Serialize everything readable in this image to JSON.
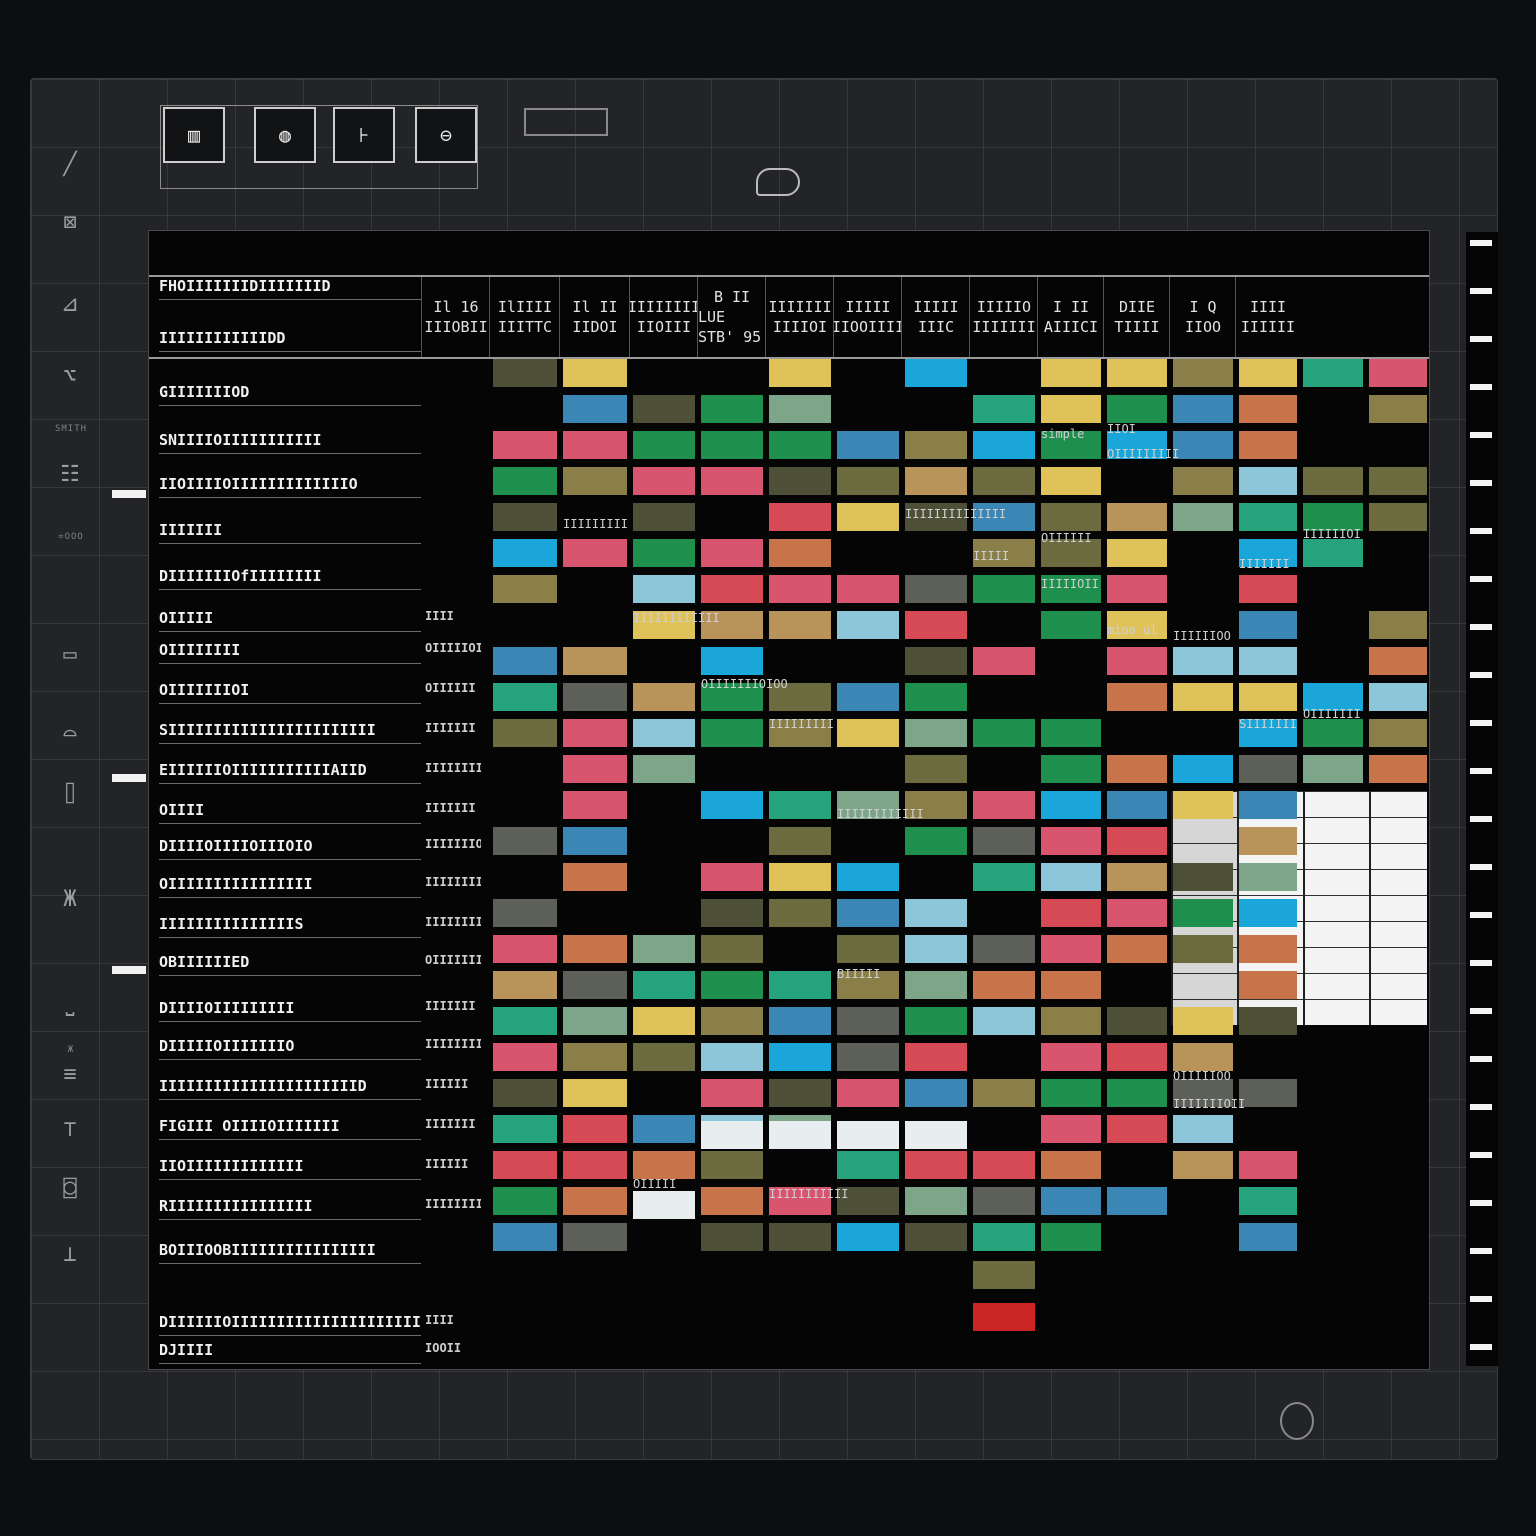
{
  "toolbar": {
    "buttons": [
      {
        "name": "grid-view-button",
        "glyph": "▥"
      },
      {
        "name": "globe-button",
        "glyph": "◍"
      },
      {
        "name": "split-button",
        "glyph": "⊦"
      },
      {
        "name": "lock-button",
        "glyph": "⊖"
      }
    ]
  },
  "left_rail": {
    "icons": [
      "╱",
      "⊠",
      "⊿",
      "⌥",
      "☷",
      "▭",
      "⌓",
      "⌷",
      "Ж",
      "⎵",
      "≡",
      "⊤",
      "⌼",
      "⊥"
    ],
    "labels": [
      "SMITH",
      "=OOO",
      "Ж"
    ]
  },
  "grid": {
    "column_headers": [
      [
        "Il 16",
        "IIIOBII"
      ],
      [
        "IlIIII",
        "IIITTC"
      ],
      [
        "Il II",
        "IIDOI"
      ],
      [
        "IIIIIIII",
        "IIOIII"
      ],
      [
        "B II",
        "LUE STB' 95"
      ],
      [
        "IIIIIII",
        "IIIIOI"
      ],
      [
        "IIIII",
        "IIOOIIII"
      ],
      [
        "IIIII",
        "IIIC"
      ],
      [
        "IIIIIO",
        "IIIIIII"
      ],
      [
        "I II",
        "AIIICI"
      ],
      [
        "DIIE",
        "TIIII"
      ],
      [
        "I Q",
        "IIOO"
      ],
      [
        "IIII",
        "IIIIII"
      ]
    ],
    "row_labels": [
      "FHOIIIIIIIDIIIIIIID",
      "IIIIIIIIIIIIDD",
      "GIIIIIIIOD",
      "SNIIIIOIIIIIIIIIII",
      "IIOIIIIOIIIIIIIIIIIIIO",
      "IIIIIII",
      "DIIIIIIIOfIIIIIIII",
      "OIIIII",
      "OIIIIIIII",
      "OIIIIIIIOI",
      "SIIIIIIIIIIIIIIIIIIIIIII",
      "EIIIIIIOIIIIIIIIIIIAIID",
      "OIIII",
      "DIIIIOIIIIOIIIOIO",
      "OIIIIIIIIIIIIIIII",
      "IIIIIIIIIIIIIIIS",
      "OBIIIIIIED",
      "DIIIIOIIIIIIIII",
      "DIIIIIOIIIIIIIO",
      "IIIIIIIIIIIIIIIIIIIIIID",
      "FIGIII OIIIIOIIIIIII",
      "IIOIIIIIIIIIIIII",
      "RIIIIIIIIIIIIIIII",
      "BOIIIOOBIIIIIIIIIIIIIIII",
      "DIIIIIIOIIIIIIIIIIIIIIIIIIIIIIIIOIIIIII",
      "DJIIII"
    ],
    "row_subs": [
      "",
      "",
      "",
      "",
      "",
      "",
      "",
      "IIII",
      "OIIIIIOI",
      "OIIIIII",
      "IIIIIII",
      "IIIIIIIIO",
      "IIIIIII",
      "IIIIIIIO",
      "IIIIIIII",
      "IIIIIIIIIIII",
      "OIIIIIII",
      "IIIIIII",
      "IIIIIIII",
      "IIIIII",
      "IIIIIII",
      "IIIIII",
      "IIIIIIIIII",
      "",
      "IIII",
      "IOOII"
    ],
    "cell_texts": [
      "IIIIIIIII",
      "IIIIIIIIIIII",
      "OIIIIIIIOIOO",
      "IIIIIIIII",
      "IIIIIIIIIIII",
      "IIIIIIIIIIIIII",
      "IIIII",
      "OIIIIII",
      "IIIIIOII",
      "IIOI",
      "OIIIIIIIII",
      "simple",
      "mioo ul",
      "IIIIIII",
      "IIIIIIOI",
      "IIIIIIOO",
      "SIIIIIII",
      "OIIIIIII",
      "IIIIIIIIIII",
      "OIIIII",
      "BIIIII",
      "OIIIIIOO",
      "IIIIIIIOII"
    ],
    "palette": {
      "yellow": "#e0c25a",
      "green": "#1f8f4e",
      "teal": "#25a37d",
      "blue": "#3a86b5",
      "cyan": "#1aa6d9",
      "red": "#d64a56",
      "pink": "#d85570",
      "olive": "#6b6b3f",
      "olive_dark": "#4d5036",
      "khaki": "#8a7f48",
      "tan": "#b8945a",
      "orange": "#c8744a",
      "sage": "#7da58a",
      "light_blue": "#8dc6d8",
      "white": "#e8eef0",
      "grey": "#5c6059",
      "bright_red": "#cc2525"
    }
  }
}
